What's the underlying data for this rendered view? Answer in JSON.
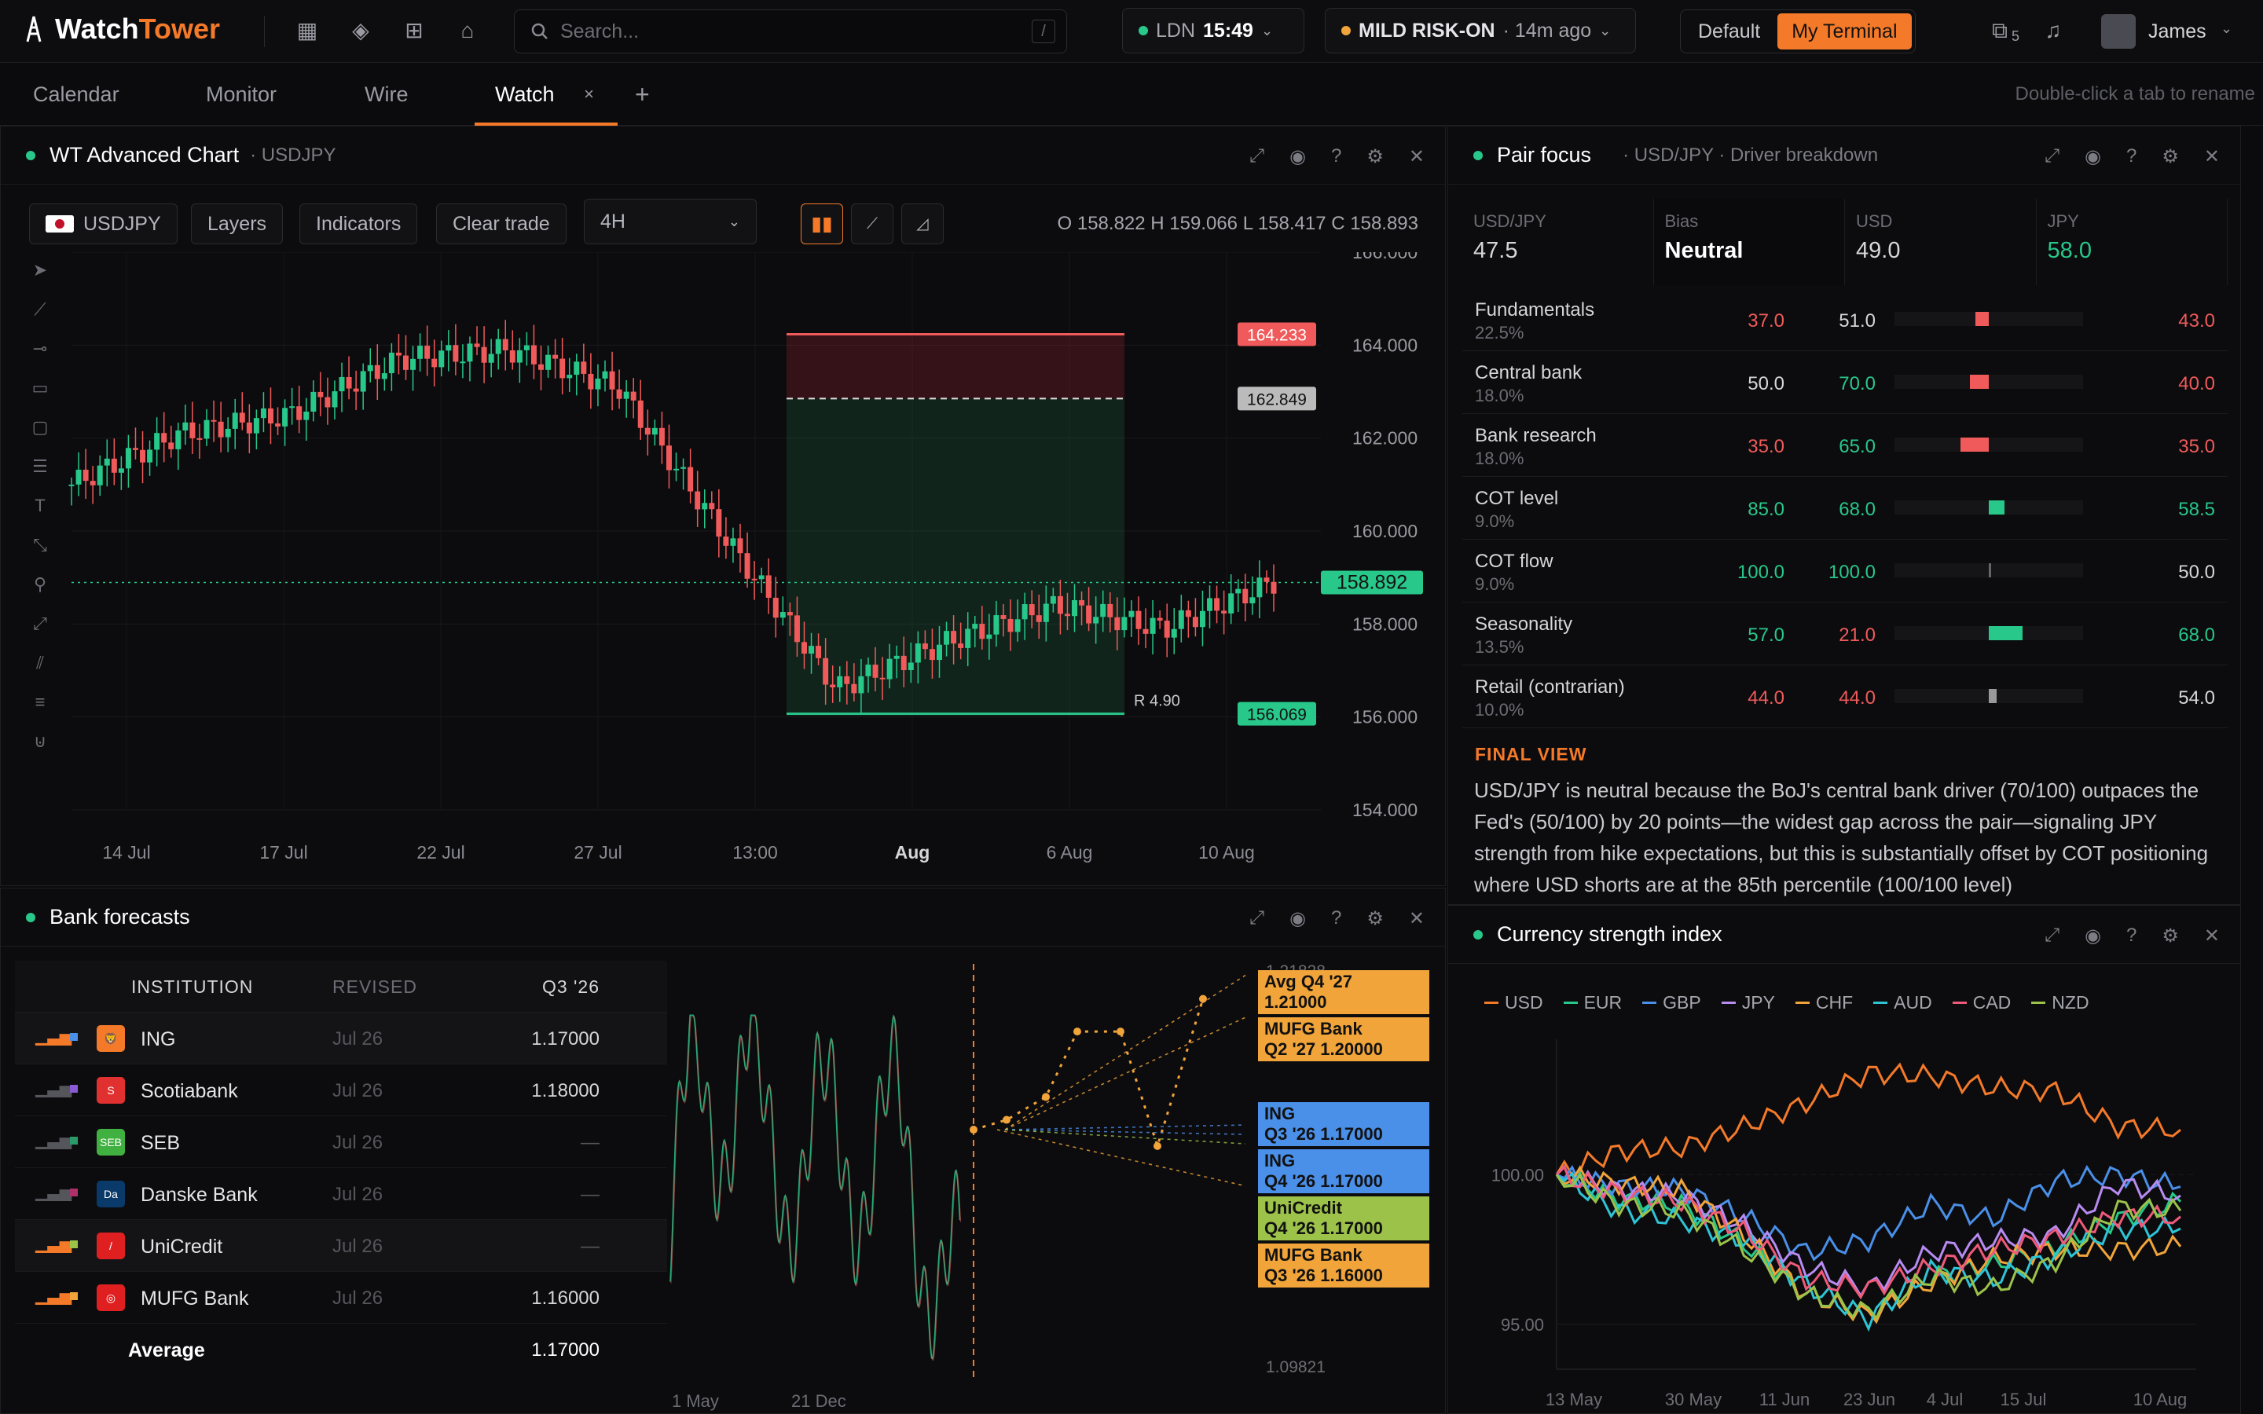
{
  "app": {
    "name_a": "Watch",
    "name_b": "Tower",
    "search_placeholder": "Search...",
    "search_key": "/",
    "clock_city": "LDN",
    "clock_time": "15:49",
    "risk": "MILD RISK-ON",
    "risk_age": "· 14m ago",
    "layout_default": "Default",
    "layout_active": "My Terminal",
    "user": "James",
    "notif_count": "5"
  },
  "tabs": [
    {
      "label": "Calendar"
    },
    {
      "label": "Monitor"
    },
    {
      "label": "Wire"
    },
    {
      "label": "Watch"
    }
  ],
  "tab_hint": "Double-click a tab to rename",
  "chart_panel": {
    "title": "WT Advanced Chart",
    "sub": "· USDJPY",
    "symbol": "USDJPY",
    "layers": "Layers",
    "indicators": "Indicators",
    "clear": "Clear trade",
    "interval": "4H",
    "ohlc": "O 158.822 H 159.066 L 158.417 C 158.893",
    "risk_reward": "R 4.90",
    "tags": {
      "stop": "164.233",
      "entry": "162.849",
      "last": "158.892",
      "target": "156.069"
    }
  },
  "chart_data": [
    {
      "type": "line",
      "title": "",
      "symbol": "USDJPY",
      "interval": "4H",
      "y_ticks": [
        "166.000",
        "164.000",
        "162.000",
        "160.000",
        "158.000",
        "156.000",
        "154.000"
      ],
      "x_ticks": [
        "14 Jul",
        "17 Jul",
        "22 Jul",
        "27 Jul",
        "13:00",
        "Aug",
        "6 Aug",
        "10 Aug"
      ],
      "ylim": [
        154,
        166
      ],
      "x": [
        "14 Jul",
        "17 Jul",
        "22 Jul",
        "27 Jul",
        "29 Jul",
        "30 Jul",
        "31 Jul",
        "1 Aug",
        "6 Aug",
        "8 Aug",
        "10 Aug",
        "11 Aug"
      ],
      "values": [
        161.0,
        162.1,
        162.5,
        163.7,
        163.9,
        163.1,
        159.8,
        156.6,
        157.6,
        158.4,
        157.9,
        158.9
      ],
      "levels": {
        "stop": 164.233,
        "entry": 162.849,
        "last": 158.892,
        "target": 156.069
      }
    },
    {
      "type": "line",
      "title": "",
      "x_ticks": [
        "1 May",
        "21 Dec"
      ],
      "y_ticks": [
        "1.21828",
        "1.09821"
      ],
      "ylim": [
        1.09821,
        1.21828
      ],
      "series": [
        {
          "name": "Avg Q4 '27",
          "values": [
            1.17,
            1.21
          ]
        },
        {
          "name": "MUFG Bank Q2 '27",
          "values": [
            1.16,
            1.2
          ]
        },
        {
          "name": "ING Q3 '26",
          "values": [
            1.17,
            1.17
          ]
        },
        {
          "name": "ING Q4 '26",
          "values": [
            1.17,
            1.17
          ]
        },
        {
          "name": "UniCredit Q4 '26",
          "values": [
            1.17,
            1.17
          ]
        },
        {
          "name": "MUFG Bank Q3 '26",
          "values": [
            1.16,
            1.16
          ]
        }
      ]
    },
    {
      "type": "line",
      "title": "",
      "x_ticks": [
        "13 May",
        "30 May",
        "11 Jun",
        "23 Jun",
        "4 Jul",
        "15 Jul",
        "10 Aug"
      ],
      "y_ticks": [
        "100.00",
        "95.00"
      ],
      "ylim": [
        93.5,
        104
      ],
      "series": [
        {
          "name": "USD",
          "color": "#f47a2a",
          "values": [
            100,
            100.8,
            100.9,
            101.6,
            102.4,
            103.4,
            103.3,
            102.9,
            102.8,
            101.6,
            101.5
          ]
        },
        {
          "name": "EUR",
          "color": "#28c78a",
          "values": [
            100,
            99.2,
            99.0,
            97.7,
            96.0,
            95.4,
            96.6,
            97.0,
            97.6,
            98.5,
            99.1
          ]
        },
        {
          "name": "GBP",
          "color": "#4a8fe8",
          "values": [
            100,
            99.6,
            99.5,
            98.6,
            97.4,
            97.8,
            99.0,
            98.5,
            99.8,
            100.0,
            99.6
          ]
        },
        {
          "name": "JPY",
          "color": "#b78bf0",
          "values": [
            100,
            99.5,
            99.3,
            98.3,
            96.9,
            96.2,
            97.4,
            97.8,
            98.0,
            99.7,
            99.3
          ]
        },
        {
          "name": "CHF",
          "color": "#f0a43a",
          "values": [
            100,
            99.7,
            99.5,
            98.0,
            96.0,
            95.3,
            96.4,
            97.2,
            97.5,
            97.5,
            97.6
          ]
        },
        {
          "name": "AUD",
          "color": "#2ec4d6",
          "values": [
            100,
            98.8,
            98.5,
            97.8,
            96.3,
            95.2,
            96.8,
            96.5,
            97.3,
            98.2,
            98.2
          ]
        },
        {
          "name": "CAD",
          "color": "#f05a7a",
          "values": [
            100,
            99.4,
            99.1,
            98.1,
            96.5,
            96.2,
            96.9,
            97.5,
            97.9,
            98.6,
            98.6
          ]
        },
        {
          "name": "NZD",
          "color": "#9cc24a",
          "values": [
            100,
            99.0,
            98.8,
            97.5,
            96.0,
            95.4,
            96.6,
            96.2,
            97.1,
            98.9,
            98.8
          ]
        }
      ]
    }
  ],
  "pair": {
    "title": "Pair focus",
    "sub": "· USD/JPY · Driver breakdown",
    "summary": [
      {
        "label": "USD/JPY",
        "value": "47.5"
      },
      {
        "label": "Bias",
        "value": "Neutral"
      },
      {
        "label": "USD",
        "value": "49.0"
      },
      {
        "label": "JPY",
        "value": "58.0"
      }
    ],
    "drivers": [
      {
        "name": "Fundamentals",
        "weight": "22.5%",
        "usd": "37.0",
        "jpy": "51.0",
        "score": "43.0",
        "val": 43.0,
        "col": "#f05a5a",
        "usd_col": "#f05a5a",
        "jpy_col": "#d6d6da",
        "score_col": "#f05a5a"
      },
      {
        "name": "Central bank",
        "weight": "18.0%",
        "usd": "50.0",
        "jpy": "70.0",
        "score": "40.0",
        "val": 40.0,
        "col": "#f05a5a",
        "usd_col": "#d6d6da",
        "jpy_col": "#28c78a",
        "score_col": "#f05a5a"
      },
      {
        "name": "Bank research",
        "weight": "18.0%",
        "usd": "35.0",
        "jpy": "65.0",
        "score": "35.0",
        "val": 35.0,
        "col": "#f05a5a",
        "usd_col": "#f05a5a",
        "jpy_col": "#28c78a",
        "score_col": "#f05a5a"
      },
      {
        "name": "COT level",
        "weight": "9.0%",
        "usd": "85.0",
        "jpy": "68.0",
        "score": "58.5",
        "val": 58.5,
        "col": "#28c78a",
        "usd_col": "#28c78a",
        "jpy_col": "#28c78a",
        "score_col": "#28c78a"
      },
      {
        "name": "COT flow",
        "weight": "9.0%",
        "usd": "100.0",
        "jpy": "100.0",
        "score": "50.0",
        "val": 50.0,
        "col": "#666",
        "usd_col": "#28c78a",
        "jpy_col": "#28c78a",
        "score_col": "#d6d6da"
      },
      {
        "name": "Seasonality",
        "weight": "13.5%",
        "usd": "57.0",
        "jpy": "21.0",
        "score": "68.0",
        "val": 68.0,
        "col": "#28c78a",
        "usd_col": "#28c78a",
        "jpy_col": "#f05a5a",
        "score_col": "#28c78a"
      },
      {
        "name": "Retail (contrarian)",
        "weight": "10.0%",
        "usd": "44.0",
        "jpy": "44.0",
        "score": "54.0",
        "val": 54.0,
        "col": "#999",
        "usd_col": "#f05a5a",
        "jpy_col": "#f05a5a",
        "score_col": "#d6d6da"
      }
    ],
    "final_title": "FINAL VIEW",
    "final_text": "USD/JPY is neutral because the BoJ's central bank driver (70/100) outpaces the Fed's (50/100) by 20 points—the widest gap across the pair—signaling JPY strength from hike expectations, but this is substantially offset by COT positioning where USD shorts are at the 85th percentile (100/100 level)"
  },
  "banks": {
    "title": "Bank forecasts",
    "headers": [
      "INSTITUTION",
      "REVISED",
      "Q3 '26"
    ],
    "rows": [
      {
        "name": "ING",
        "rev": "Jul 26",
        "val": "1.17000",
        "sq": "#4a8fe8",
        "logo": "#f47a2a",
        "lt": "🦁"
      },
      {
        "name": "Scotiabank",
        "rev": "Jul 26",
        "val": "1.18000",
        "sq": "#8a5ad6",
        "logo": "#e03030",
        "lt": "S"
      },
      {
        "name": "SEB",
        "rev": "Jul 26",
        "val": "—",
        "sq": "#2a9a6a",
        "logo": "#40b040",
        "lt": "SEB"
      },
      {
        "name": "Danske Bank",
        "rev": "Jul 26",
        "val": "—",
        "sq": "#b0306a",
        "logo": "#0a3a6a",
        "lt": "Da"
      },
      {
        "name": "UniCredit",
        "rev": "Jul 26",
        "val": "—",
        "sq": "#9cc24a",
        "logo": "#e02020",
        "lt": "/"
      },
      {
        "name": "MUFG Bank",
        "rev": "Jul 26",
        "val": "1.16000",
        "sq": "#f0a43a",
        "logo": "#e02020",
        "lt": "◎"
      }
    ],
    "avg_label": "Average",
    "avg_val": "1.17000",
    "callouts": [
      {
        "l1": "Avg Q4 '27",
        "l2": "1.21000",
        "bg": "#f0a43a"
      },
      {
        "l1": "MUFG Bank",
        "l2": "Q2 '27 1.20000",
        "bg": "#f0a43a"
      },
      {
        "l1": "ING",
        "l2": "Q3 '26 1.17000",
        "bg": "#4a8fe8"
      },
      {
        "l1": "ING",
        "l2": "Q4 '26 1.17000",
        "bg": "#4a8fe8"
      },
      {
        "l1": "UniCredit",
        "l2": "Q4 '26 1.17000",
        "bg": "#9cc24a"
      },
      {
        "l1": "MUFG Bank",
        "l2": "Q3 '26 1.16000",
        "bg": "#f0a43a"
      }
    ]
  },
  "csi": {
    "title": "Currency strength index"
  }
}
